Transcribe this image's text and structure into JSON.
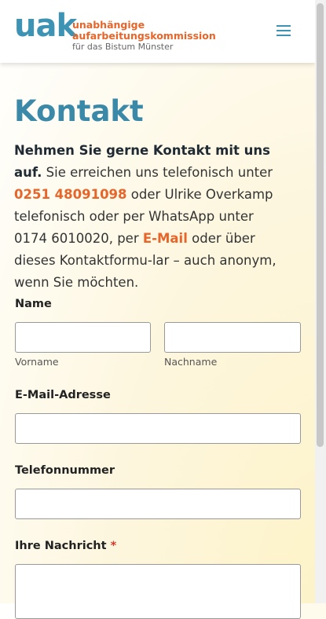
{
  "header": {
    "logo_mark": "uak",
    "logo_line1": "unabhängige",
    "logo_line2": "aufarbeitungskommission",
    "logo_line3": "für das Bistum Münster"
  },
  "page": {
    "title": "Kontakt"
  },
  "intro": {
    "bold": "Nehmen Sie gerne Kontakt mit uns auf.",
    "text1": " Sie erreichen uns telefonisch unter ",
    "phone": "0251 48091098",
    "text2": " oder Ulrike Overkamp telefonisch oder per WhatsApp unter 0174 6010020, per ",
    "email_link": "E-Mail",
    "text3": " oder über dieses Kontaktformu-lar – auch anonym, wenn Sie möchten."
  },
  "form": {
    "name_label": "Name",
    "first_name_sub": "Vorname",
    "last_name_sub": "Nachname",
    "email_label": "E-Mail-Adresse",
    "phone_label": "Telefonnummer",
    "message_label": "Ihre Nachricht",
    "required_mark": "*",
    "first_name_value": "",
    "last_name_value": "",
    "email_value": "",
    "phone_value": ""
  },
  "colors": {
    "brand_blue": "#3d93b3",
    "accent_orange": "#e8652a"
  },
  "icons": {
    "menu": "hamburger-menu-icon"
  }
}
